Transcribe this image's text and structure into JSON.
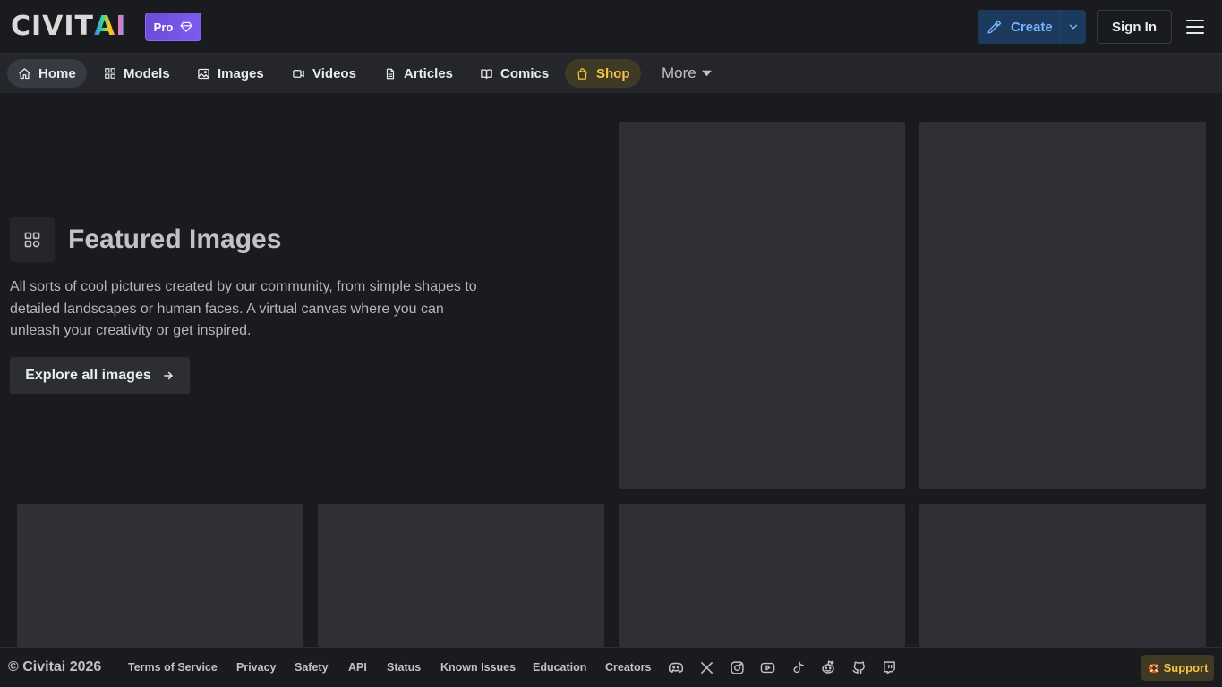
{
  "header": {
    "logo_main": "CIVIT",
    "logo_accent": "AI",
    "pro_label": "Pro",
    "create_label": "Create",
    "signin_label": "Sign In"
  },
  "nav": {
    "items": [
      {
        "label": "Home",
        "icon": "home-icon"
      },
      {
        "label": "Models",
        "icon": "grid-icon"
      },
      {
        "label": "Images",
        "icon": "photo-icon"
      },
      {
        "label": "Videos",
        "icon": "video-icon"
      },
      {
        "label": "Articles",
        "icon": "file-text-icon"
      },
      {
        "label": "Comics",
        "icon": "book-icon"
      },
      {
        "label": "Shop",
        "icon": "shopping-bag-icon"
      }
    ],
    "more_label": "More"
  },
  "hero": {
    "title": "Featured Images",
    "description": "All sorts of cool pictures created by our community, from simple shapes to detailed landscapes or human faces. A virtual canvas where you can unleash your creativity or get inspired.",
    "cta_label": "Explore all images"
  },
  "footer": {
    "copyright": "© Civitai 2026",
    "links": [
      "Terms of Service",
      "Privacy",
      "Safety",
      "API",
      "Status",
      "Known Issues",
      "Education",
      "Creators"
    ],
    "socials": [
      "discord-icon",
      "x-icon",
      "instagram-icon",
      "youtube-icon",
      "tiktok-icon",
      "reddit-icon",
      "github-icon",
      "twitch-icon"
    ],
    "support_label": "Support"
  },
  "colors": {
    "background": "#1a1b1e",
    "nav_background": "#25262b",
    "accent_blue": "#74b3ff",
    "shop_gold": "#f6c445",
    "pro_purple": "#7c5cf0"
  }
}
